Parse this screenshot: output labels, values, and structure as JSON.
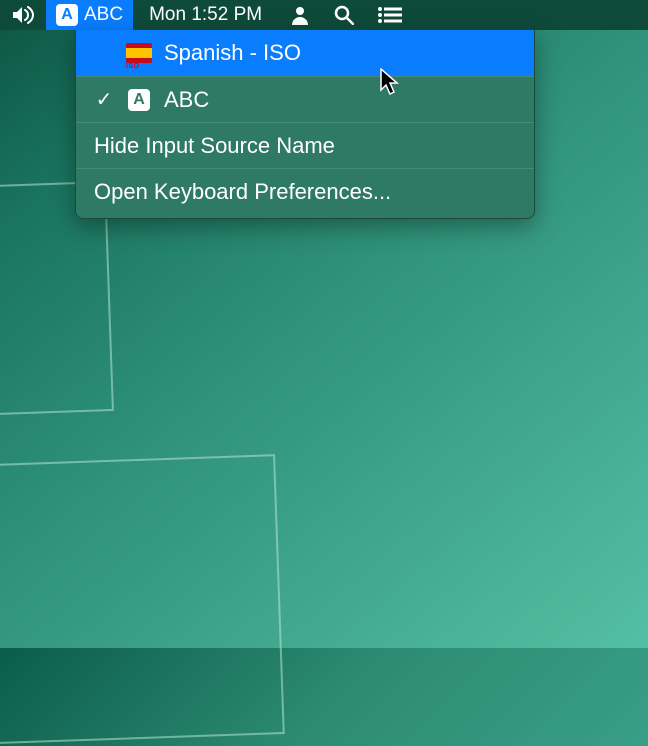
{
  "menubar": {
    "input_source_label": "ABC",
    "clock": "Mon 1:52 PM"
  },
  "dropdown": {
    "items": [
      {
        "label": "Spanish - ISO",
        "checked": false,
        "highlighted": true,
        "icon": "flag-es"
      },
      {
        "label": "ABC",
        "checked": true,
        "highlighted": false,
        "icon": "a-icon"
      }
    ],
    "hide_label": "Hide Input Source Name",
    "prefs_label": "Open Keyboard Preferences..."
  }
}
